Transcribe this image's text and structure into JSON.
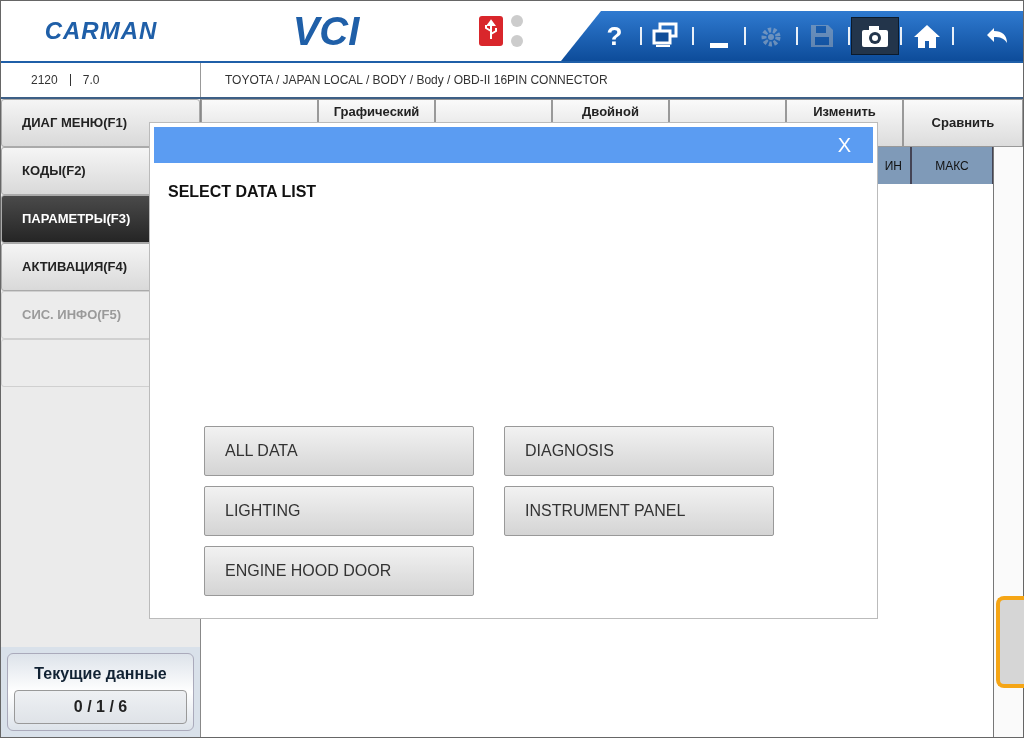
{
  "header": {
    "logo": "CARMAN",
    "product": "VCI",
    "status_lights": [
      {
        "on": false
      },
      {
        "on": false
      }
    ],
    "tools": [
      {
        "kind": "help",
        "text": "?",
        "disabled": false,
        "selected": false
      },
      {
        "kind": "windows",
        "disabled": false,
        "selected": false
      },
      {
        "kind": "minimize",
        "disabled": false,
        "selected": false
      },
      {
        "kind": "settings",
        "disabled": true,
        "selected": false
      },
      {
        "kind": "save",
        "disabled": true,
        "selected": false
      },
      {
        "kind": "camera",
        "disabled": false,
        "selected": true
      },
      {
        "kind": "home",
        "disabled": false,
        "selected": false
      },
      {
        "kind": "back",
        "disabled": false,
        "selected": false
      }
    ]
  },
  "info": {
    "code": "2120",
    "version": "7.0",
    "path": "TOYOTA / JAPAN LOCAL / BODY / Body / OBD-II 16PIN CONNECTOR"
  },
  "toolbar": [
    {
      "kind": "blank"
    },
    {
      "kind": "text",
      "label": "Графический"
    },
    {
      "kind": "blank"
    },
    {
      "kind": "text",
      "label": "Двойной"
    },
    {
      "kind": "blank"
    },
    {
      "kind": "text",
      "label": "Изменить"
    },
    {
      "kind": "text",
      "label": "Сравнить"
    }
  ],
  "menu": [
    {
      "label": "ДИАГ МЕНЮ(F1)",
      "selected": false,
      "disabled": false
    },
    {
      "label": "КОДЫ(F2)",
      "selected": false,
      "disabled": false
    },
    {
      "label": "ПАРАМЕТРЫ(F3)",
      "selected": true,
      "disabled": false
    },
    {
      "label": "АКТИВАЦИЯ(F4)",
      "selected": false,
      "disabled": false
    },
    {
      "label": "СИС. ИНФО(F5)",
      "selected": false,
      "disabled": true
    },
    {
      "selected": false,
      "disabled": true
    }
  ],
  "table": {
    "columns": [
      "ИН",
      "МАКС"
    ]
  },
  "counter": {
    "title": "Текущие данные",
    "value": "0 / 1 / 6"
  },
  "dialog": {
    "close": "X",
    "title": "SELECT DATA LIST",
    "options": [
      "ALL DATA",
      "DIAGNOSIS",
      "LIGHTING",
      "INSTRUMENT PANEL",
      "ENGINE HOOD DOOR"
    ]
  }
}
